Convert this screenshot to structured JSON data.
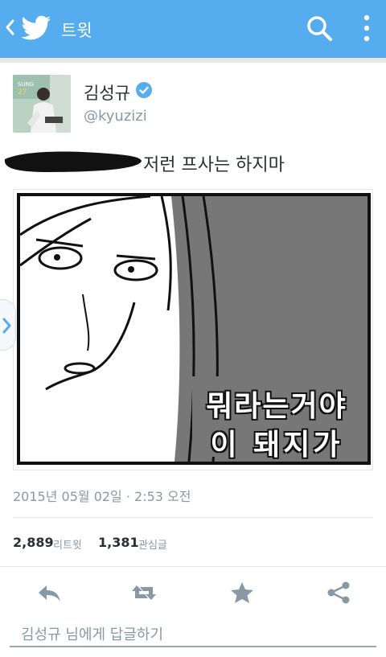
{
  "appbar": {
    "title": "트윗",
    "back_icon": "chevron-left-icon",
    "logo_icon": "twitter-bird-icon",
    "search_icon": "search-icon",
    "more_icon": "more-vertical-icon",
    "color": "#55acee"
  },
  "tweet": {
    "author_name": "김성규",
    "author_handle": "@kyuzizi",
    "verified": true,
    "text": "저런 프사는 하지마",
    "media": {
      "caption_line1": "뭐라는거야",
      "caption_line2": "이 돼지가"
    },
    "timestamp": "2015년 05월 02일 · 2:53 오전"
  },
  "stats": {
    "retweets": "2,889",
    "retweets_label": "리트윗",
    "favorites": "1,381",
    "favorites_label": "관심글"
  },
  "actions": {
    "reply_icon": "reply-icon",
    "retweet_icon": "retweet-icon",
    "favorite_icon": "star-icon",
    "share_icon": "share-icon"
  },
  "reply_box": {
    "placeholder": "김성규 님에게 답글하기"
  }
}
